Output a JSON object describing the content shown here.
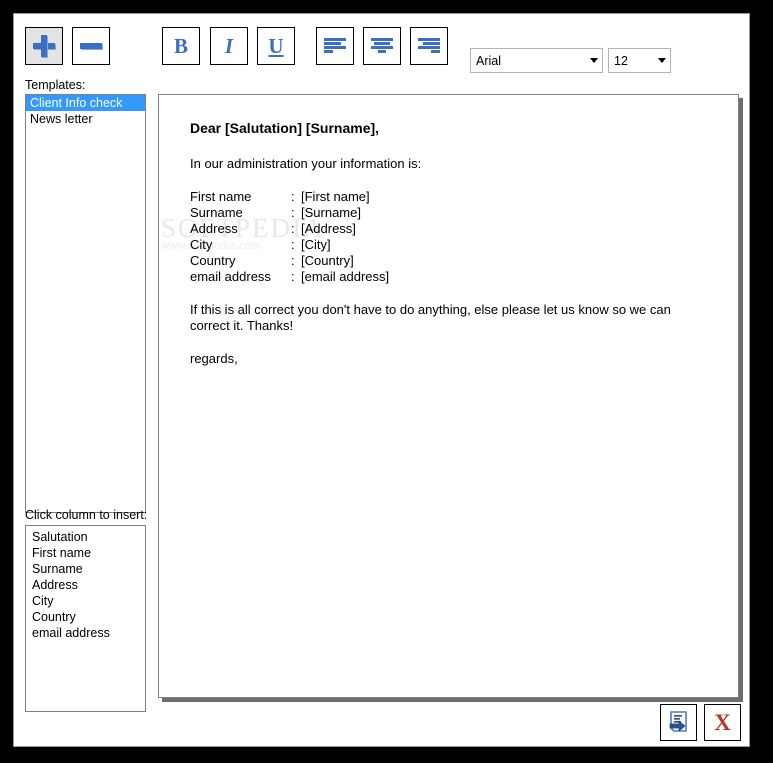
{
  "toolbar": {
    "add_label": "+",
    "remove_label": "−",
    "bold_label": "B",
    "italic_label": "I",
    "underline_label": "U",
    "align_left_name": "align-left-icon",
    "align_center_name": "align-center-icon",
    "align_right_name": "align-right-icon",
    "font_family_value": "Arial",
    "font_size_value": "12"
  },
  "sidebar": {
    "templates_label": "Templates:",
    "templates": [
      {
        "label": "Client Info check",
        "selected": true
      },
      {
        "label": "News letter",
        "selected": false
      }
    ],
    "columns_label": "Click column to insert:",
    "columns": [
      {
        "label": "Salutation"
      },
      {
        "label": "First name"
      },
      {
        "label": "Surname"
      },
      {
        "label": "Address"
      },
      {
        "label": "City"
      },
      {
        "label": "Country"
      },
      {
        "label": "email address"
      }
    ]
  },
  "editor": {
    "greeting": "Dear [Salutation] [Surname],",
    "intro": "In our administration your information is:",
    "fields": [
      {
        "name": "First name",
        "sep": ":",
        "value": "[First name]"
      },
      {
        "name": "Surname",
        "sep": ":",
        "value": "[Surname]"
      },
      {
        "name": "Address",
        "sep": ":",
        "value": "[Address]"
      },
      {
        "name": "City",
        "sep": ":",
        "value": "[City]"
      },
      {
        "name": "Country",
        "sep": ":",
        "value": "[Country]"
      },
      {
        "name": "email address",
        "sep": ":",
        "value": "[email address]"
      }
    ],
    "paragraph": "If this is all correct you don't have to do anything, else please let us know so we can correct it. Thanks!",
    "signoff": "regards,"
  },
  "watermark": {
    "main": "SOFTPEDIA",
    "sub": "www.softpedia.com"
  },
  "footer": {
    "save_icon_name": "save-export-icon",
    "close_label": "X"
  },
  "colors": {
    "accent_blue": "#3a6fc4",
    "selection_blue": "#3399ff",
    "close_red": "#b23a22",
    "frame_black": "#000000"
  }
}
